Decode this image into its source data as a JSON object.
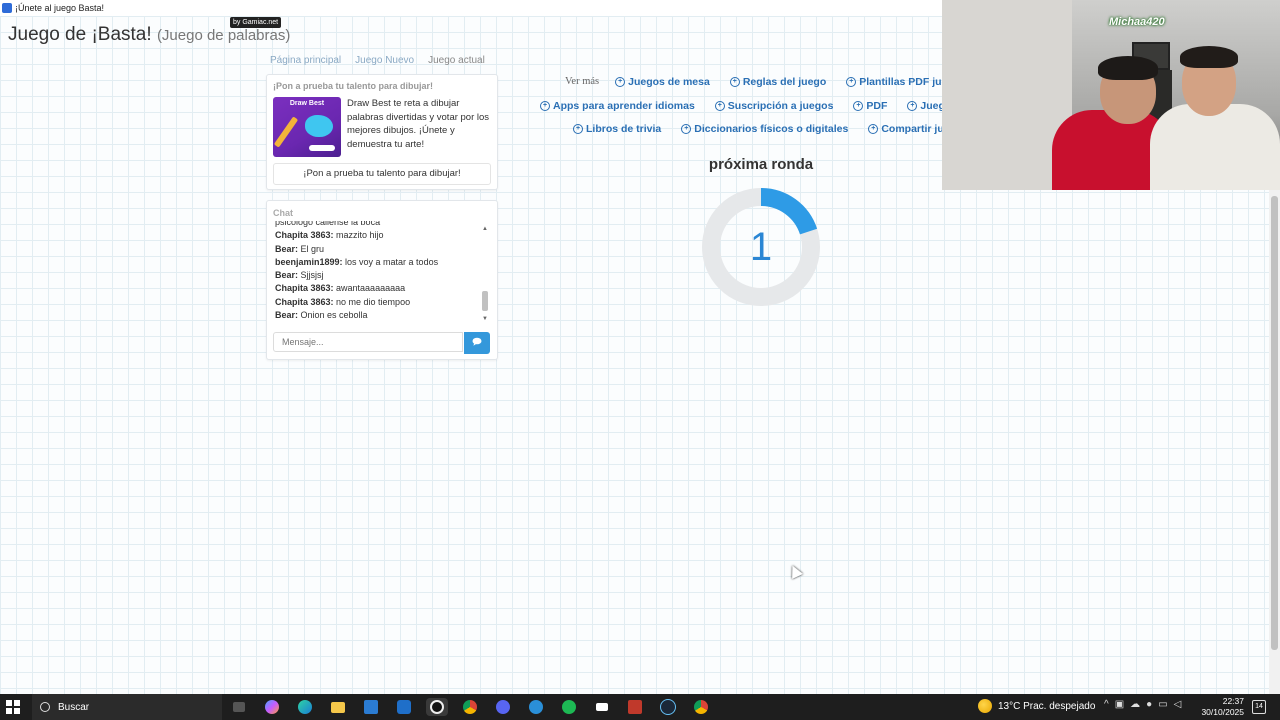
{
  "window": {
    "title": "¡Únete al juego Basta!",
    "badge": "by Gamiac.net"
  },
  "header": {
    "title": "Juego de ¡Basta!",
    "subtitle": "(Juego de palabras)"
  },
  "breadcrumbs": [
    "Página principal",
    "Juego Nuevo",
    "Juego actual"
  ],
  "promo": {
    "heading": "¡Pon a prueba tu talento para dibujar!",
    "thumb_title": "Draw Best",
    "text": "Draw Best te reta a dibujar palabras divertidas y votar por los mejores dibujos. ¡Únete y demuestra tu arte!",
    "button": "¡Pon a prueba tu talento para dibujar!"
  },
  "chat": {
    "heading": "Chat",
    "partial_line": "psicologo callense la boca",
    "messages": [
      {
        "user": "Chapita 3863:",
        "text": " mazzito hijo"
      },
      {
        "user": "Bear:",
        "text": " El gru"
      },
      {
        "user": "beenjamin1899:",
        "text": " los voy a matar a todos"
      },
      {
        "user": "Bear:",
        "text": " Sjjsjsj"
      },
      {
        "user": "Chapita 3863:",
        "text": " awantaaaaaaaaa"
      },
      {
        "user": "Chapita 3863:",
        "text": " no me dio tiempoo"
      },
      {
        "user": "Bear:",
        "text": " Onion es cebolla"
      }
    ],
    "input_placeholder": "Mensaje...",
    "send_icon": "chat-bubble-icon"
  },
  "links": {
    "see_more": "Ver más",
    "row1": [
      "Juegos de mesa",
      "Reglas del juego",
      "Plantillas PDF juegos"
    ],
    "row2": [
      "Apps para aprender idiomas",
      "Suscripción a juegos",
      "PDF",
      "Juegos"
    ],
    "row3": [
      "Libros de trivia",
      "Diccionarios físicos o digitales",
      "Compartir juegos"
    ]
  },
  "round": {
    "label": "próxima ronda",
    "countdown": "1",
    "progress_fraction": 0.2,
    "ring_color": "#2e9be6",
    "track_color": "#e6e8ea"
  },
  "webcam": {
    "tag": "Michaa420"
  },
  "taskbar": {
    "search": "Buscar",
    "apps": [
      "task-view",
      "copilot",
      "edge",
      "file-explorer",
      "store",
      "outlook",
      "obs",
      "chrome",
      "discord",
      "app",
      "spotify",
      "capcut",
      "voicemeeter",
      "steam",
      "chrome-profile"
    ],
    "weather": "13°C  Prac. despejado",
    "time": "22:37",
    "date": "30/10/2025",
    "notifications": "14"
  }
}
